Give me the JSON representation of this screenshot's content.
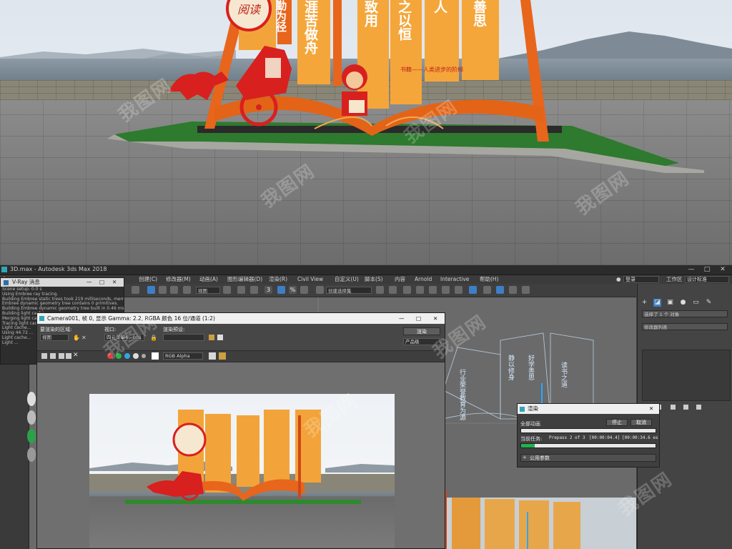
{
  "scene": {
    "sign_words": [
      "勤为径",
      "涯苦做舟",
      "致用",
      "之以恒",
      "人",
      "善思"
    ],
    "sign_caption": "书籍——人类进步的阶梯",
    "logo_text": "阅读",
    "watermark": "我图网"
  },
  "app": {
    "title": "3D.max - Autodesk 3ds Max 2018",
    "window_controls": [
      "—",
      "□",
      "✕"
    ],
    "menu": [
      "创建(C)",
      "修改器(M)",
      "动画(A)",
      "图形编辑器(D)",
      "渲染(R)",
      "Civil View",
      "自定义(U)",
      "脚本(S)",
      "内容",
      "Arnold",
      "Interactive",
      "帮助(H)"
    ],
    "left_menu_fragment": "文",
    "login_label": "登录",
    "workspace_label": "工作区",
    "workspace_value": "设计标准",
    "toolbar": {
      "view_dropdown": "视图",
      "selection_set_dropdown": "创建选择集",
      "percent_icon_label": "%",
      "angle_snap_label": "3"
    }
  },
  "command_panel": {
    "selection_text": "选择了 1 个 对象",
    "modifier_list_label": "修改器列表"
  },
  "vray": {
    "title": "V-Ray 消息",
    "log": [
      "Scene setup: 0.0 s",
      "Using Embree ray tracing.",
      "Building Embree static trees took 219 milliseconds, memory u",
      "Embree dynamic geometry tree contains 0 primitives.",
      "Building Embree dynamic geometry tree built in 0.46 ms",
      "Building light cache...",
      "Merging light cache...",
      "Tracing light cache...",
      "Light cache...",
      "Using 44.72 ...",
      "Light cache...",
      "Light ..."
    ]
  },
  "frame_buffer": {
    "title": "Camera001, 帧 0, 显示 Gamma: 2.2, RGBA 颜色 16 位/通道 (1:2)",
    "area_label": "要渲染的区域:",
    "area_value": "视图",
    "viewport_label": "视口:",
    "viewport_value": "四元菜单4 - 001",
    "preset_label": "渲染预设:",
    "preset_value": "",
    "render_button": "渲染",
    "product_value": "产品级",
    "channel_value": "RGB Alpha",
    "window_controls": [
      "—",
      "□",
      "✕"
    ]
  },
  "viewport_text": [
    "行业荣誉教育为源",
    "静以修身",
    "好学善思",
    "读书之道"
  ],
  "progress": {
    "title": "渲染",
    "all_anim": "全部动画",
    "current_task_label": "当前任务:",
    "current_task_value": "Prepass 2 of 3",
    "elapsed": "[00:00:04.4]",
    "remaining": "[00:00:34.6 es",
    "pause_button": "停止",
    "cancel_button": "取消",
    "section": "公用参数",
    "progress_fraction": 0.1,
    "total_fraction": 0.0
  },
  "colors": {
    "accent_blue": "#3d7fc5",
    "progress_green": "#22b14c",
    "sign_orange": "#f0902a",
    "sign_red": "#d8201e"
  }
}
